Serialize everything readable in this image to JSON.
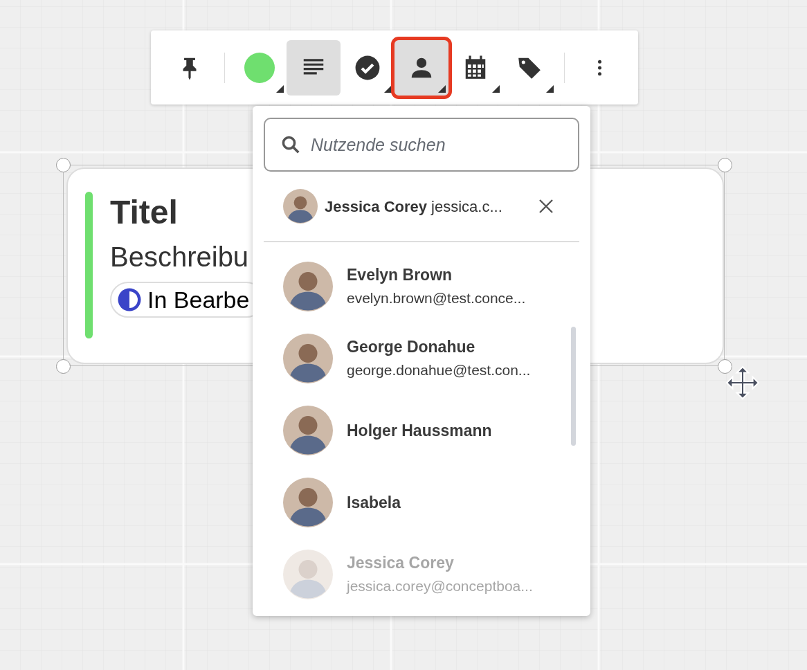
{
  "toolbar": {
    "buttons": [
      {
        "kind": "pin",
        "selected": false,
        "has_menu": false,
        "highlighted": false
      },
      {
        "kind": "color",
        "selected": false,
        "has_menu": true,
        "highlighted": false,
        "color": "#6fdf6f"
      },
      {
        "kind": "text",
        "selected": true,
        "has_menu": false,
        "highlighted": false
      },
      {
        "kind": "status",
        "selected": false,
        "has_menu": true,
        "highlighted": false
      },
      {
        "kind": "assignee",
        "selected": true,
        "has_menu": true,
        "highlighted": true
      },
      {
        "kind": "date",
        "selected": false,
        "has_menu": true,
        "highlighted": false
      },
      {
        "kind": "tag",
        "selected": false,
        "has_menu": true,
        "highlighted": false
      },
      {
        "kind": "more",
        "selected": false,
        "has_menu": false,
        "highlighted": false
      }
    ]
  },
  "card": {
    "title": "Titel",
    "description": "Beschreibu",
    "status": {
      "label": "In Bearbe",
      "color": "#3a44c8"
    }
  },
  "assignee_menu": {
    "search": {
      "placeholder": "Nutzende suchen"
    },
    "assigned": [
      {
        "name": "Jessica Corey",
        "email": "jessica.c..."
      }
    ],
    "users": [
      {
        "name": "Evelyn Brown",
        "email": "evelyn.brown@test.conce...",
        "disabled": false
      },
      {
        "name": "George Donahue",
        "email": "george.donahue@test.con...",
        "disabled": false
      },
      {
        "name": "Holger Haussmann",
        "disabled": false
      },
      {
        "name": "Isabela",
        "disabled": false
      },
      {
        "name": "Jessica Corey",
        "email": "jessica.corey@conceptboa...",
        "disabled": true
      }
    ]
  }
}
